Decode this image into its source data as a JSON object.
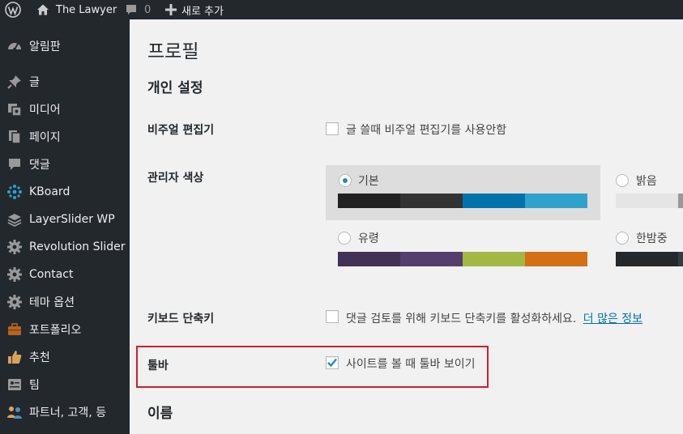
{
  "adminbar": {
    "site_name": "The Lawyer",
    "comments_count": "0",
    "new_label": "새로 추가"
  },
  "sidebar": {
    "items": [
      {
        "label": "알림판",
        "icon": "dashboard-icon"
      },
      {
        "label": "글",
        "icon": "pin-icon"
      },
      {
        "label": "미디어",
        "icon": "media-icon"
      },
      {
        "label": "페이지",
        "icon": "pages-icon"
      },
      {
        "label": "댓글",
        "icon": "comments-icon"
      },
      {
        "label": "KBoard",
        "icon": "kboard-icon"
      },
      {
        "label": "LayerSlider WP",
        "icon": "layers-icon"
      },
      {
        "label": "Revolution Slider",
        "icon": "gear-icon"
      },
      {
        "label": "Contact",
        "icon": "gear-icon"
      },
      {
        "label": "테마 옵션",
        "icon": "gear-icon"
      },
      {
        "label": "포트폴리오",
        "icon": "briefcase-icon"
      },
      {
        "label": "추천",
        "icon": "thumbs-up-icon"
      },
      {
        "label": "팀",
        "icon": "team-icon"
      },
      {
        "label": "파트너, 고객, 등",
        "icon": "partners-icon"
      }
    ]
  },
  "main": {
    "page_title": "프로필",
    "section_personal": "개인 설정",
    "visual_editor": {
      "label": "비주얼 편집기",
      "checkbox_text": "글 쓸때 비주얼 편집기를 사용안함",
      "checked": false
    },
    "admin_color": {
      "label": "관리자 색상",
      "schemes": [
        {
          "name": "기본",
          "selected": true,
          "colors": [
            "#222222",
            "#333333",
            "#0073aa",
            "#2ea2cc"
          ]
        },
        {
          "name": "밝음",
          "selected": false,
          "colors": [
            "#e5e5e5",
            "#999999",
            "#d64e07",
            "#04a4cc"
          ]
        },
        {
          "name": "유령",
          "selected": false,
          "colors": [
            "#413256",
            "#523f6d",
            "#a3b745",
            "#d46f15"
          ]
        },
        {
          "name": "한밤중",
          "selected": false,
          "colors": [
            "#25282b",
            "#363b3f",
            "#69a8bb",
            "#e14d43"
          ]
        }
      ]
    },
    "keyboard_shortcuts": {
      "label": "키보드 단축키",
      "checkbox_text": "댓글 검토를 위해 키보드 단축키를 활성화하세요.",
      "link_text": "더 많은 정보",
      "checked": false
    },
    "toolbar": {
      "label": "툴바",
      "checkbox_text": "사이트를 볼 때 툴바 보이기",
      "checked": true
    },
    "section_name": "이름"
  },
  "colors": {
    "adminbar_bg": "#23282d",
    "sidebar_bg": "#23282d",
    "content_bg": "#f1f1f1",
    "highlight_border": "#d01f2b",
    "link": "#0073aa"
  }
}
